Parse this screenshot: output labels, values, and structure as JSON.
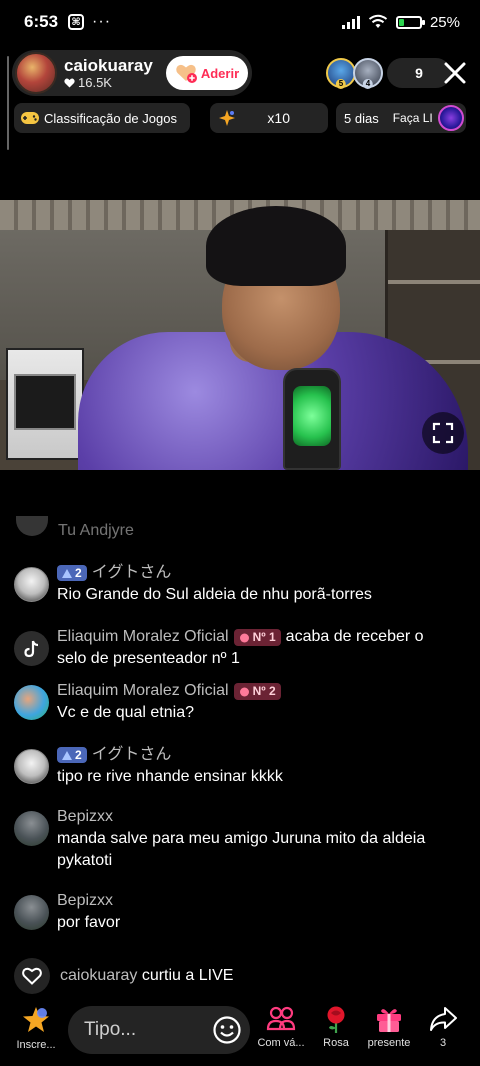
{
  "status_bar": {
    "time": "6:53",
    "app_badge": "⌘",
    "dots": "···",
    "battery_percent": "25%",
    "battery_level": 0.25
  },
  "host": {
    "name": "caiokuaray",
    "likes": "16.5K",
    "join_label": "Aderir"
  },
  "viewers": {
    "top": [
      {
        "rank": "5"
      },
      {
        "rank": "4"
      }
    ],
    "count": "9"
  },
  "chips": {
    "ranking": "Classificação de Jogos",
    "multiplier": "x10",
    "days": "5 dias",
    "faca": "Faça LI"
  },
  "chat": {
    "faded": "Tu Andjyre",
    "messages": [
      {
        "user": "イグトさん",
        "level": "2",
        "text": "Rio Grande do Sul aldeia de nhu porã-torres",
        "avatar": "anime"
      },
      {
        "user": "Eliaquim Moralez Oficial",
        "rank": "Nº 1",
        "text_inline": "acaba de receber o",
        "text": "selo de presenteador nº 1",
        "avatar": "tiktok"
      },
      {
        "user": "Eliaquim Moralez Oficial",
        "rank": "Nº 2",
        "text": "Vc e de qual etnia?",
        "avatar": "colored"
      },
      {
        "user": "イグトさん",
        "level": "2",
        "text": "tipo re rive nhande ensinar kkkk",
        "avatar": "anime"
      },
      {
        "user": "Bepizxx",
        "text": "manda salve para meu amigo Juruna mito da aldeia pykatoti",
        "avatar": "person"
      },
      {
        "user": "Bepizxx",
        "text": "por favor",
        "avatar": "person"
      }
    ],
    "system": {
      "user": "caiokuaray",
      "text": "curtiu a LIVE"
    }
  },
  "bottom_bar": {
    "subscribe": "Inscre...",
    "input_placeholder": "Tipo...",
    "collab": "Com vá...",
    "rose": "Rosa",
    "gift": "presente",
    "share_count": "3"
  },
  "colors": {
    "accent": "#fe2c55",
    "level_badge": "#4b67b8",
    "rank_badge": "#6b2334"
  }
}
